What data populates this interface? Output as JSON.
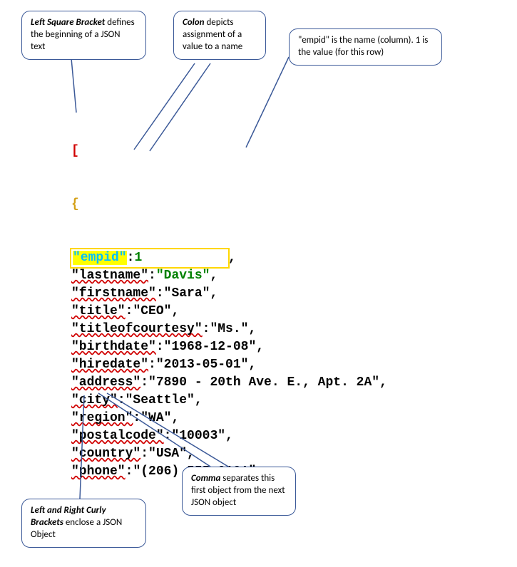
{
  "callouts": {
    "left_bracket": {
      "bold": "Left Square Bracket",
      "rest": " defines the beginning of a JSON text"
    },
    "colon": {
      "bold": "Colon",
      "rest": " depicts assignment of a value to a name"
    },
    "empid": "\"empid\" is the name (column). 1 is the value (for this row)",
    "curly": {
      "bold": "Left and Right Curly Brackets",
      "rest": " enclose a JSON Object"
    },
    "comma": {
      "bold": "Comma",
      "rest": " separates this first object from the next JSON object"
    }
  },
  "json_content": {
    "open_bracket": "[",
    "open_brace": "{",
    "fields": [
      {
        "key": "\"empid\"",
        "value": "1",
        "highlighted": true,
        "value_type": "number"
      },
      {
        "key": "\"lastname\"",
        "value": "\"Davis\"",
        "value_green": true
      },
      {
        "key": "\"firstname\"",
        "value": "\"Sara\""
      },
      {
        "key": "\"title\"",
        "value": "\"CEO\""
      },
      {
        "key": "\"titleofcourtesy\"",
        "value": "\"Ms.\""
      },
      {
        "key": "\"birthdate\"",
        "value": "\"1968-12-08\""
      },
      {
        "key": "\"hiredate\"",
        "value": "\"2013-05-01\""
      },
      {
        "key": "\"address\"",
        "value": "\"7890 - 20th Ave. E., Apt. 2A\""
      },
      {
        "key": "\"city\"",
        "value": "\"Seattle\""
      },
      {
        "key": "\"region\"",
        "value": "\"WA\""
      },
      {
        "key": "\"postalcode\"",
        "value": "\"10003\""
      },
      {
        "key": "\"country\"",
        "value": "\"USA\""
      },
      {
        "key": "\"phone\"",
        "value": "\"(206) 555-0101\"",
        "last": true
      }
    ],
    "close_brace": "}",
    "trailing_comma": ","
  }
}
